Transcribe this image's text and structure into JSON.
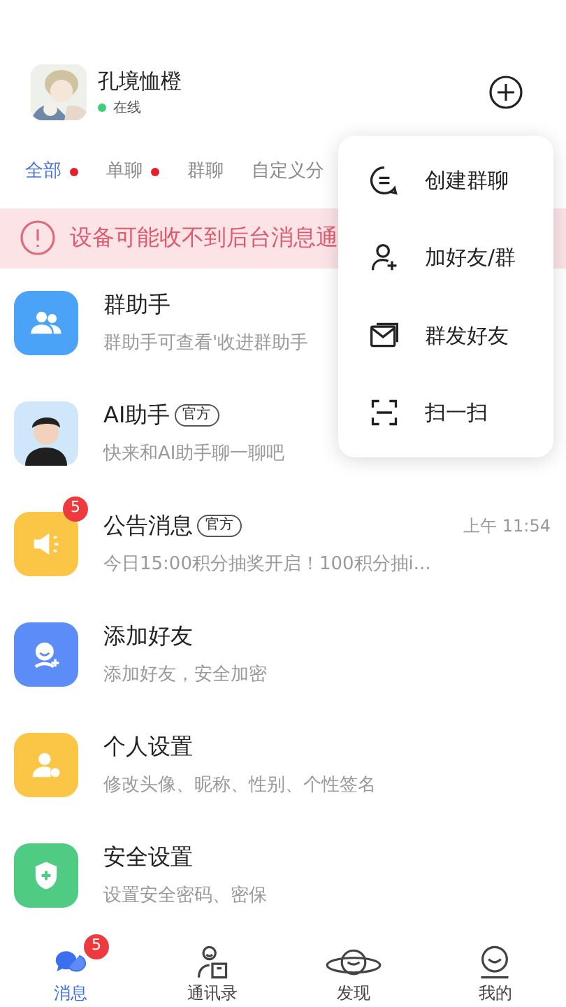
{
  "user": {
    "name": "孔境恤橙",
    "status": "在线",
    "online": true
  },
  "filter_tabs": [
    {
      "label": "全部",
      "selected": true,
      "unread": true
    },
    {
      "label": "单聊",
      "selected": false,
      "unread": true
    },
    {
      "label": "群聊",
      "selected": false,
      "unread": false
    },
    {
      "label": "自定义分",
      "selected": false,
      "unread": false
    }
  ],
  "notice": "设备可能收不到后台消息通",
  "conversations": [
    {
      "kind": "group",
      "color": "#4aa3f7",
      "title": "群助手",
      "subtitle": "群助手可查看'收进群助手"
    },
    {
      "kind": "ai",
      "title": "AI助手",
      "tag": "官方",
      "subtitle": "快来和AI助手聊一聊吧"
    },
    {
      "kind": "notice",
      "color": "#fbc546",
      "title": "公告消息",
      "tag": "官方",
      "badge": "5",
      "time": "上午 11:54",
      "subtitle": "今日15:00积分抽奖开启！100积分抽i..."
    },
    {
      "kind": "add_friend",
      "color": "#5b8cf7",
      "title": "添加好友",
      "subtitle": "添加好友，安全加密"
    },
    {
      "kind": "profile",
      "color": "#fbc546",
      "title": "个人设置",
      "subtitle": "修改头像、昵称、性别、个性签名"
    },
    {
      "kind": "security",
      "color": "#4fcb84",
      "title": "安全设置",
      "subtitle": "设置安全密码、密保"
    }
  ],
  "popup_menu": [
    {
      "kind": "chat",
      "label": "创建群聊"
    },
    {
      "kind": "add_user",
      "label": "加好友/群"
    },
    {
      "kind": "mail",
      "label": "群发好友"
    },
    {
      "kind": "scan",
      "label": "扫一扫"
    }
  ],
  "bottom_nav": [
    {
      "kind": "messages",
      "label": "消息",
      "selected": true,
      "badge": "5"
    },
    {
      "kind": "contacts",
      "label": "通讯录",
      "selected": false
    },
    {
      "kind": "discover",
      "label": "发现",
      "selected": false
    },
    {
      "kind": "me",
      "label": "我的",
      "selected": false
    }
  ]
}
